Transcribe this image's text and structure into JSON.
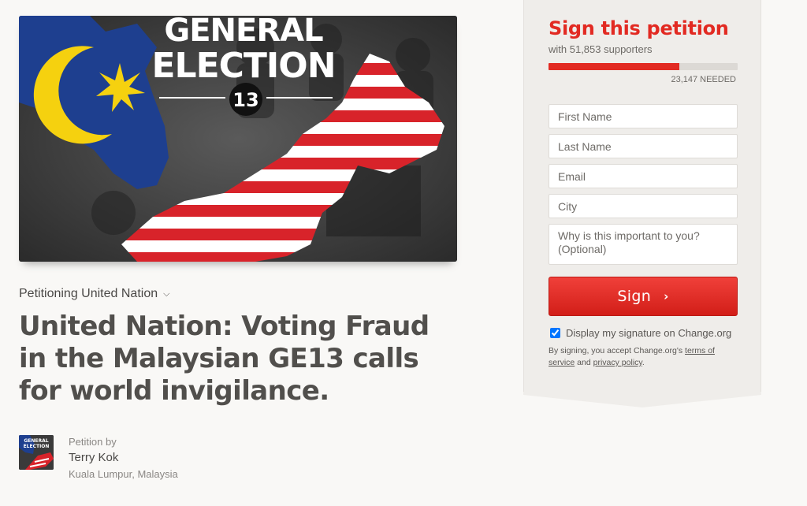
{
  "hero": {
    "text_line1": "GENERAL",
    "text_line2": "ELECTION",
    "number": "13"
  },
  "petition": {
    "petitioning_label": "Petitioning United Nation",
    "title": "United Nation: Voting Fraud in the Malaysian GE13 calls for world invigilance."
  },
  "author": {
    "by_label": "Petition by",
    "name": "Terry Kok",
    "location": "Kuala Lumpur, Malaysia"
  },
  "sign_panel": {
    "heading": "Sign this petition",
    "supporters_text": "with 51,853 supporters",
    "progress_fraction": 0.69,
    "needed_text": "23,147 NEEDED",
    "first_name_placeholder": "First Name",
    "last_name_placeholder": "Last Name",
    "email_placeholder": "Email",
    "city_placeholder": "City",
    "reason_placeholder": "Why is this important to you? (Optional)",
    "sign_button": "Sign",
    "display_signature_label": "Display my signature on Change.org",
    "display_signature_checked": true,
    "legal_prefix": "By signing, you accept Change.org's ",
    "terms_link": "terms of service",
    "legal_and": " and ",
    "privacy_link": "privacy policy",
    "legal_suffix": "."
  },
  "colors": {
    "accent_red": "#e22a22",
    "flag_blue": "#1e3f8f",
    "flag_yellow": "#f5d10f"
  }
}
